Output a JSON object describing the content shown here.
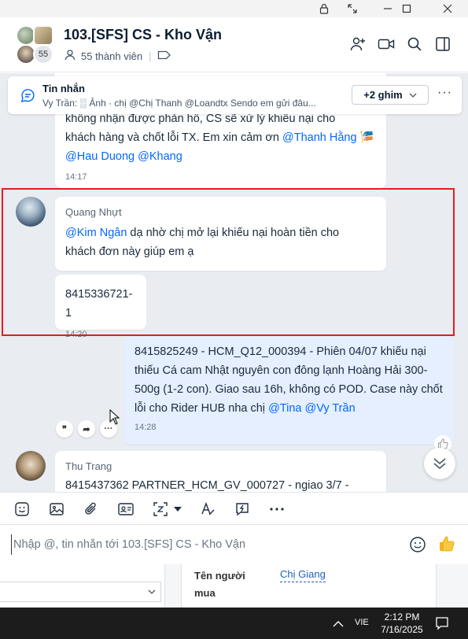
{
  "window": {
    "buttons": [
      "lock",
      "restore",
      "minimize",
      "maximize",
      "close"
    ]
  },
  "header": {
    "title": "103.[SFS] CS - Kho Vận",
    "members": "55 thành viên",
    "avatar_count": "55"
  },
  "pinned": {
    "title": "Tin nhắn",
    "text": "Vy Trần: ░ Ảnh · chị @Chị Thanh @Loandtx Sendo em gửi đâu...",
    "pins_label": "+2 ghim",
    "more": "···"
  },
  "messages": {
    "m1": {
      "line1": "không nhận được phản hồ,  CS sẽ xử lý khiếu nại cho",
      "line2": "khách hàng và chốt lỗi TX. Em xin cảm ơn ",
      "mention1": "@Thanh Hằng",
      "emoji": "🎏",
      "mention2": "@Hau Duong",
      "mention3": "@Khang",
      "time": "14:17"
    },
    "m2": {
      "sender": "Quang Nhựt",
      "mention": "@Kim Ngân",
      "text1": " dạ nhờ chị mở lại khiếu nại hoàn tiền cho",
      "text2": "khách đơn này giúp em ạ"
    },
    "m3": {
      "text": "8415336721-1",
      "time": "14:20"
    },
    "m4": {
      "line1": "8415825249 - HCM_Q12_000394 - Phiên 04/07 khiếu nại",
      "line2": "thiếu Cá cam Nhật nguyên con đông lạnh Hoàng Hải 300-",
      "line3": "500g (1-2 con). Giao sau 16h, không có POD. Case này chốt",
      "line4": "lỗi cho Rider HUB nha chị ",
      "mention1": "@Tina",
      "mention2": "@Vy Trần",
      "time": "14:28"
    },
    "m5": {
      "sender": "Thu Trang",
      "text": "8415437362 PARTNER_HCM_GV_000727 - ngiao 3/7 -"
    }
  },
  "reactions": [
    "❞",
    "➦",
    "···"
  ],
  "composer": {
    "placeholder": "Nhập @, tin nhắn tới 103.[SFS] CS - Kho Vận"
  },
  "background_window": {
    "label": "Tên người mua",
    "value": "Chị Giang"
  },
  "taskbar": {
    "lang": "VIE",
    "time": "2:12 PM",
    "date": "7/16/2025"
  },
  "colors": {
    "accent": "#0068ff",
    "selection": "#e01e1e",
    "own_bubble": "#e5efff"
  }
}
